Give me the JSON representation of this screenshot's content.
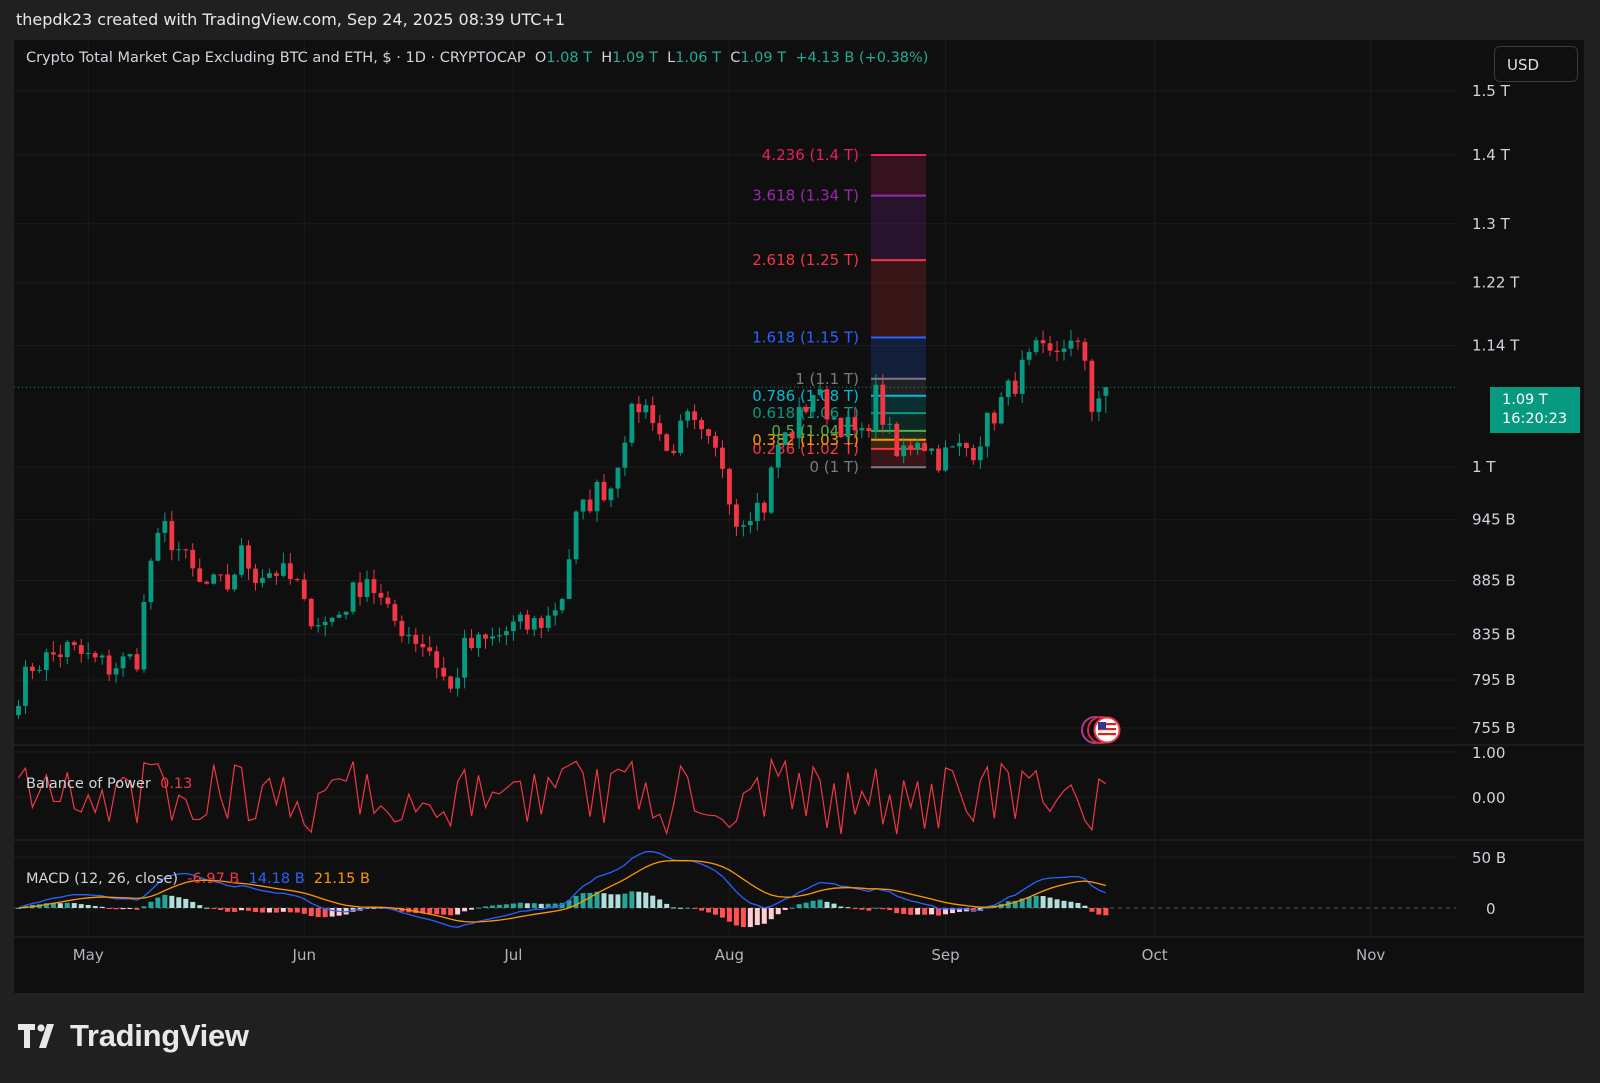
{
  "caption": "thepdk23 created with TradingView.com, Sep 24, 2025 08:39 UTC+1",
  "legend": {
    "title": "Crypto Total Market Cap Excluding BTC and ETH, $ · 1D · CRYPTOCAP",
    "o_label": "O",
    "o_val": "1.08 T",
    "h_label": "H",
    "h_val": "1.09 T",
    "l_label": "L",
    "l_val": "1.06 T",
    "c_label": "C",
    "c_val": "1.09 T",
    "change": "+4.13 B (+0.38%)"
  },
  "currency": "USD",
  "price_tag": {
    "price": "1.09 T",
    "countdown": "16:20:23"
  },
  "indicators": {
    "bop": {
      "name": "Balance of Power",
      "value": "0.13"
    },
    "macd": {
      "name": "MACD (12, 26, close)",
      "hist": "-6.97 B",
      "macd": "14.18 B",
      "signal": "21.15 B"
    }
  },
  "brand": "TradingView",
  "colors": {
    "up": "#089981",
    "down": "#f23645",
    "macd": "#2962ff",
    "signal": "#ff9800",
    "bop": "#f23645"
  },
  "chart_data": {
    "type": "candlestick",
    "title": "Crypto Total Market Cap Excluding BTC and ETH, $ · 1D · CRYPTOCAP",
    "x_ticks": [
      "May",
      "Jun",
      "Jul",
      "Aug",
      "Sep",
      "Oct",
      "Nov"
    ],
    "y_ticks": [
      "755 B",
      "795 B",
      "835 B",
      "885 B",
      "945 B",
      "1 T",
      "1.09 T",
      "1.14 T",
      "1.22 T",
      "1.3 T",
      "1.4 T",
      "1.5 T"
    ],
    "y_tick_values": [
      755,
      795,
      835,
      885,
      945,
      1000,
      1090,
      1140,
      1220,
      1300,
      1400,
      1500
    ],
    "y_scale": "log",
    "start_date": "2025-04-21",
    "anchors": [
      [
        "2025-04-21",
        785
      ],
      [
        "2025-04-23",
        808
      ],
      [
        "2025-04-28",
        822
      ],
      [
        "2025-05-04",
        806
      ],
      [
        "2025-05-08",
        815
      ],
      [
        "2025-05-10",
        905
      ],
      [
        "2025-05-12",
        935
      ],
      [
        "2025-05-14",
        915
      ],
      [
        "2025-05-17",
        880
      ],
      [
        "2025-05-21",
        880
      ],
      [
        "2025-05-23",
        910
      ],
      [
        "2025-05-25",
        892
      ],
      [
        "2025-05-28",
        895
      ],
      [
        "2025-05-31",
        880
      ],
      [
        "2025-06-01",
        858
      ],
      [
        "2025-06-04",
        845
      ],
      [
        "2025-06-06",
        855
      ],
      [
        "2025-06-10",
        890
      ],
      [
        "2025-06-13",
        852
      ],
      [
        "2025-06-15",
        842
      ],
      [
        "2025-06-19",
        822
      ],
      [
        "2025-06-22",
        785
      ],
      [
        "2025-06-24",
        822
      ],
      [
        "2025-06-28",
        830
      ],
      [
        "2025-07-01",
        842
      ],
      [
        "2025-07-03",
        842
      ],
      [
        "2025-07-06",
        850
      ],
      [
        "2025-07-08",
        872
      ],
      [
        "2025-07-10",
        945
      ],
      [
        "2025-07-13",
        975
      ],
      [
        "2025-07-15",
        980
      ],
      [
        "2025-07-17",
        1040
      ],
      [
        "2025-07-19",
        1070
      ],
      [
        "2025-07-21",
        1060
      ],
      [
        "2025-07-23",
        1015
      ],
      [
        "2025-07-26",
        1050
      ],
      [
        "2025-07-28",
        1030
      ],
      [
        "2025-07-31",
        1005
      ],
      [
        "2025-08-02",
        945
      ],
      [
        "2025-08-04",
        958
      ],
      [
        "2025-08-06",
        960
      ],
      [
        "2025-08-08",
        1025
      ],
      [
        "2025-08-10",
        1040
      ],
      [
        "2025-08-13",
        1085
      ],
      [
        "2025-08-16",
        1055
      ],
      [
        "2025-08-20",
        1030
      ],
      [
        "2025-08-22",
        1080
      ],
      [
        "2025-08-25",
        1010
      ],
      [
        "2025-08-28",
        1035
      ],
      [
        "2025-08-31",
        1010
      ],
      [
        "2025-09-03",
        1020
      ],
      [
        "2025-09-05",
        1022
      ],
      [
        "2025-09-08",
        1060
      ],
      [
        "2025-09-12",
        1110
      ],
      [
        "2025-09-14",
        1130
      ],
      [
        "2025-09-16",
        1125
      ],
      [
        "2025-09-18",
        1145
      ],
      [
        "2025-09-21",
        1125
      ],
      [
        "2025-09-22",
        1070
      ],
      [
        "2025-09-24",
        1090
      ]
    ],
    "last": {
      "open": 1080,
      "high": 1090,
      "low": 1060,
      "close": 1090
    },
    "fib_levels": [
      {
        "ratio": "0",
        "value": "1 T",
        "label": "0 (1 T)",
        "color": "#787b86"
      },
      {
        "ratio": "0.236",
        "value": "1.02 T",
        "label": "0.236 (1.02 T)",
        "color": "#f23645"
      },
      {
        "ratio": "0.382",
        "value": "1.03 T",
        "label": "0.382 (1.03 T)",
        "color": "#ff9800"
      },
      {
        "ratio": "0.5",
        "value": "1.04 T",
        "label": "0.5 (1.04 T)",
        "color": "#4caf50"
      },
      {
        "ratio": "0.618",
        "value": "1.06 T",
        "label": "0.618 (1.06 T)",
        "color": "#089981"
      },
      {
        "ratio": "0.786",
        "value": "1.08 T",
        "label": "0.786 (1.08 T)",
        "color": "#00bcd4"
      },
      {
        "ratio": "1",
        "value": "1.1 T",
        "label": "1 (1.1 T)",
        "color": "#787b86"
      },
      {
        "ratio": "1.618",
        "value": "1.15 T",
        "label": "1.618 (1.15 T)",
        "color": "#2962ff"
      },
      {
        "ratio": "2.618",
        "value": "1.25 T",
        "label": "2.618 (1.25 T)",
        "color": "#f23645"
      },
      {
        "ratio": "3.618",
        "value": "1.34 T",
        "label": "3.618 (1.34 T)",
        "color": "#9c27b0"
      },
      {
        "ratio": "4.236",
        "value": "1.4 T",
        "label": "4.236 (1.4 T)",
        "color": "#e91e63"
      }
    ],
    "bop_ticks": [
      "1.00",
      "0.00"
    ],
    "macd_ticks": [
      "50 B",
      "0"
    ]
  }
}
